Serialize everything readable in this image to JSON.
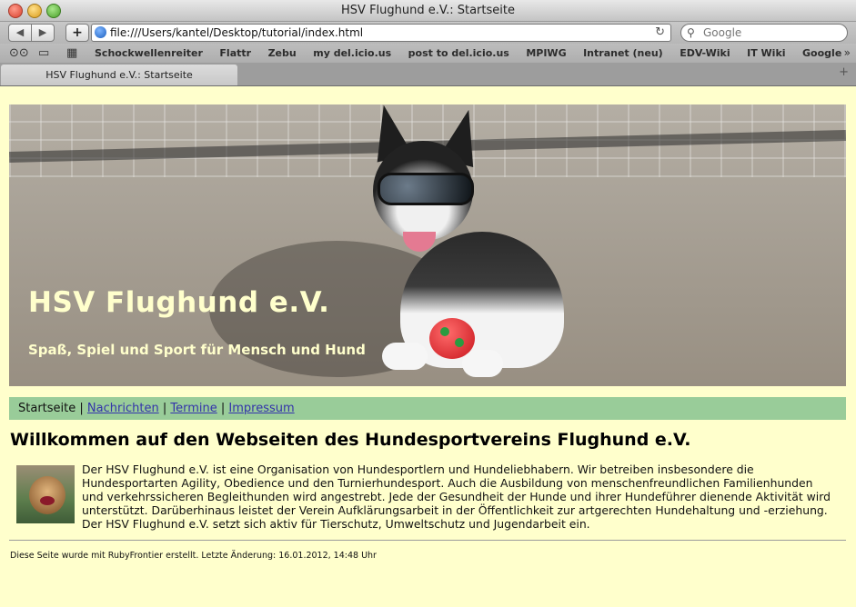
{
  "window": {
    "title": "HSV Flughund e.V.: Startseite"
  },
  "toolbar": {
    "url": "file:///Users/kantel/Desktop/tutorial/index.html",
    "search_placeholder": "Google"
  },
  "bookmarks": [
    "Schockwellenreiter",
    "Flattr",
    "Zebu",
    "my del.icio.us",
    "post to del.icio.us",
    "MPIWG",
    "Intranet (neu)",
    "EDV-Wiki",
    "IT Wiki",
    "Google"
  ],
  "tabs": [
    {
      "label": "HSV Flughund e.V.: Startseite"
    }
  ],
  "site": {
    "title": "HSV Flughund e.V.",
    "subtitle": "Spaß, Spiel und Sport für Mensch und Hund"
  },
  "nav": {
    "current": "Startseite",
    "links": [
      "Nachrichten",
      "Termine",
      "Impressum"
    ],
    "separator": "|"
  },
  "main": {
    "heading": "Willkommen auf den Webseiten des Hundesportvereins Flughund e.V.",
    "paragraph": "Der HSV Flughund e.V. ist eine Organisation von Hundesportlern und Hundeliebhabern. Wir betreiben insbesondere die Hundesportarten Agility, Obedience und den Turnierhundesport. Auch die Ausbildung von menschenfreundlichen Familienhunden und verkehrssicheren Begleithunden wird angestrebt. Jede der Gesundheit der Hunde und ihrer Hundeführer dienende Aktivität wird unterstützt. Darüberhinaus leistet der Verein Aufklärungsarbeit in der Öffentlichkeit zur artgerechten Hundehaltung und -erziehung. Der HSV Flughund e.V. setzt sich aktiv für Tierschutz, Umweltschutz und Jugendarbeit ein."
  },
  "footer": {
    "text": "Diese Seite wurde mit RubyFrontier erstellt. Letzte Änderung: 16.01.2012, 14:48 Uhr"
  },
  "colors": {
    "page_bg": "#ffffcc",
    "nav_bg": "#99cc99",
    "link": "#3333aa"
  }
}
